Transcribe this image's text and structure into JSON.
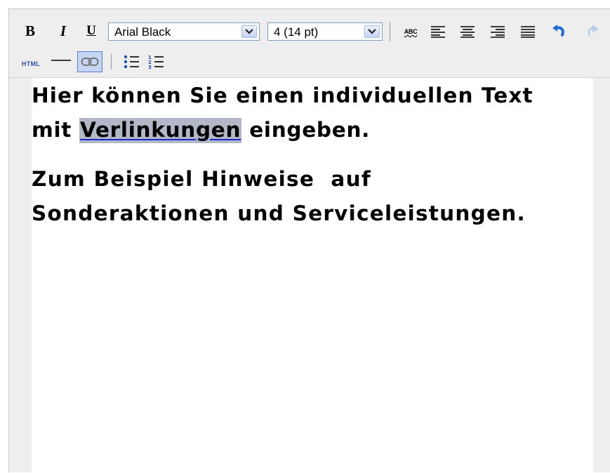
{
  "toolbar": {
    "bold_label": "B",
    "italic_label": "I",
    "underline_label": "U",
    "font_family": {
      "value": "Arial Black"
    },
    "font_size": {
      "value": "4 (14 pt)"
    },
    "spellcheck_label": "ABC",
    "html_label": "HTML",
    "icons": [
      "bold-icon",
      "italic-icon",
      "underline-icon",
      "spellcheck-icon",
      "align-left-icon",
      "align-center-icon",
      "align-right-icon",
      "align-justify-icon",
      "undo-icon",
      "redo-icon",
      "html-source-icon",
      "horizontal-rule-icon",
      "link-icon",
      "bullet-list-icon",
      "numbered-list-icon"
    ],
    "colors": {
      "undo_active": "#1f6fd6",
      "redo_disabled": "#a9c6ec",
      "link_button_active_bg": "#c5d6f5",
      "link_button_border": "#5a7fc9"
    }
  },
  "editor": {
    "paragraph1": {
      "line1": "Hier können Sie einen individuellen Text",
      "line2_before": "mit",
      "line2_link": "Verlinkungen",
      "line2_after": "eingeben."
    },
    "paragraph2": {
      "line1": "Zum Beispiel Hinweise  auf",
      "line2": "Sonderaktionen und Serviceleistungen."
    },
    "selection_color": "#b3b8c8",
    "link_underline_color": "#1b2bd0"
  }
}
